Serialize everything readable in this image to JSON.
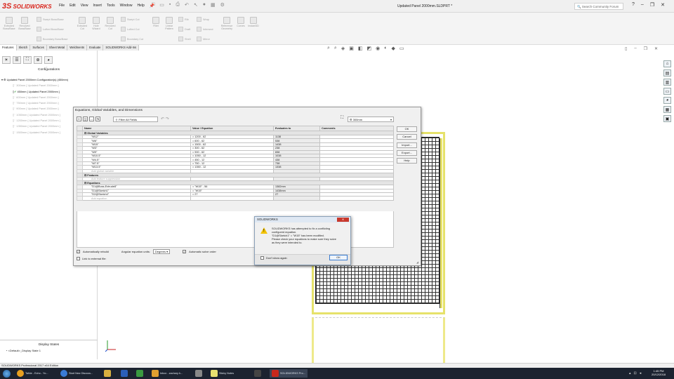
{
  "app": {
    "brand": "SOLIDWORKS",
    "document_title": "Updated Panel 2000mm.SLDPRT *",
    "search_placeholder": "Search Community Forum"
  },
  "menu": [
    "File",
    "Edit",
    "View",
    "Insert",
    "Tools",
    "Window",
    "Help"
  ],
  "ribbon": {
    "big": [
      {
        "label": "Extruded Boss/Base"
      },
      {
        "label": "Revolved Boss/Base"
      },
      {
        "label": "Extruded Cut"
      },
      {
        "label": "Hole Wizard"
      },
      {
        "label": "Revolved Cut"
      },
      {
        "label": "Fillet"
      },
      {
        "label": "Linear Pattern"
      },
      {
        "label": "Reference Geometry"
      },
      {
        "label": "Curves"
      },
      {
        "label": "Instant3D"
      }
    ],
    "small": {
      "swept_boss": "Swept Boss/Base",
      "lofted_boss": "Lofted Boss/Base",
      "boundary_boss": "Boundary Boss/Base",
      "swept_cut": "Swept Cut",
      "lofted_cut": "Lofted Cut",
      "boundary_cut": "Boundary Cut",
      "rib": "Rib",
      "wrap": "Wrap",
      "draft": "Draft",
      "intersect": "Intersect",
      "shell": "Shell",
      "mirror": "Mirror"
    }
  },
  "tabs": [
    "Features",
    "Sketch",
    "Surfaces",
    "Sheet Metal",
    "Weldments",
    "Evaluate",
    "SOLIDWORKS Add-Ins"
  ],
  "left_panel": {
    "header": "Configurations",
    "root": "Updated Panel 2000mm Configuration(s)  (450mm)",
    "configs": [
      "300mm [ Updated Panel 2000mm ]",
      "450mm [ Updated Panel 2000mm ]",
      "600mm [ Updated Panel 2000mm ]",
      "750mm [ Updated Panel 2000mm ]",
      "900mm [ Updated Panel 2000mm ]",
      "1050mm [ Updated Panel 2000mm ]",
      "1200mm [ Updated Panel 2000mm ]",
      "1350mm [ Updated Panel 2000mm ]",
      "1500mm [ Updated Panel 2000mm ]"
    ],
    "display_states_header": "Display States",
    "display_state": "<Default>_Display State 1"
  },
  "status_bar": "SOLIDWORKS Professional 2017 x64 Edition",
  "equations_dialog": {
    "title": "Equations, Global Variables, and Dimensions",
    "filter_placeholder": "Filter All Fields",
    "config": "300mm",
    "columns": [
      "Name",
      "Value / Equation",
      "Evaluates to",
      "Comments"
    ],
    "global_header": "Global Variables",
    "globals": [
      {
        "name": "\"W12\"",
        "eq": "= 1200 - 62",
        "ev": "1138"
      },
      {
        "name": "\"W6\"",
        "eq": "= 600 - 62",
        "ev": "538"
      },
      {
        "name": "\"W15\"",
        "eq": "= 1500 - 62",
        "ev": "1438"
      },
      {
        "name": "\"W3\"",
        "eq": "= 300 - 62",
        "ev": "238"
      },
      {
        "name": "\"W9\"",
        "eq": "= 900 - 62",
        "ev": "838"
      },
      {
        "name": "\"W10.5\"",
        "eq": "= 1050 - 12",
        "ev": "1038"
      },
      {
        "name": "\"W4.5\"",
        "eq": "= 450 - 12",
        "ev": "438"
      },
      {
        "name": "\"W7.5\"",
        "eq": "= 750 - 12",
        "ev": "738"
      },
      {
        "name": "\"W13.5\"",
        "eq": "= 1350 - 12",
        "ev": "1338"
      }
    ],
    "add_global": "Add global variable",
    "features_header": "Features",
    "add_feature": "Add feature suppression",
    "equations_header": "Equations",
    "equations": [
      {
        "name": "\"D1@Boss-Extrude8\"",
        "eq": "= \"W15\" - 56",
        "ev": "1382mm"
      },
      {
        "name": "\"D1@Sketch1\"",
        "eq": "= \"W15\"",
        "ev": "1438mm"
      },
      {
        "name": "\"D2@Sketch4\"",
        "eq": "= 27",
        "ev": "27"
      }
    ],
    "add_equation": "Add equation",
    "buttons": [
      "OK",
      "Cancel",
      "Import...",
      "Export...",
      "Help"
    ],
    "auto_rebuild": "Automatically rebuild",
    "angular_label": "Angular equation units:",
    "angular_value": "Degrees",
    "auto_solve": "Automatic solve order",
    "link_external": "Link to external file:"
  },
  "warning_dialog": {
    "title": "SOLIDWORKS",
    "close": "✕",
    "message_lines": [
      "SOLIDWORKS has attempted to fix a conflicting",
      "configured equation.",
      "\"D1@Sketch1\" = \"W15\" has been modified.",
      "Please check your equations to make sure they solve",
      "as they were intended to."
    ],
    "dont_show": "Don't show again",
    "ok": "OK"
  },
  "taskbar": {
    "items": [
      {
        "label": "Talkie - Echo - Yo...",
        "color": "#e8a020"
      },
      {
        "label": "Start New Discuss...",
        "color": "#3a7bd5"
      },
      {
        "label": "",
        "color": "#d8b040"
      },
      {
        "label": "",
        "color": "#2b5fb8"
      },
      {
        "label": "",
        "color": "#3a9a40"
      },
      {
        "label": "Inbox - zachary.h...",
        "color": "#e0a030"
      },
      {
        "label": "",
        "color": "#888888"
      },
      {
        "label": "Sticky Notes",
        "color": "#e8e070"
      },
      {
        "label": "",
        "color": "#444444"
      },
      {
        "label": "SOLIDWORKS Pro...",
        "color": "#c8281c"
      }
    ],
    "time": "1:45 PM",
    "date": "20/12/2018"
  }
}
